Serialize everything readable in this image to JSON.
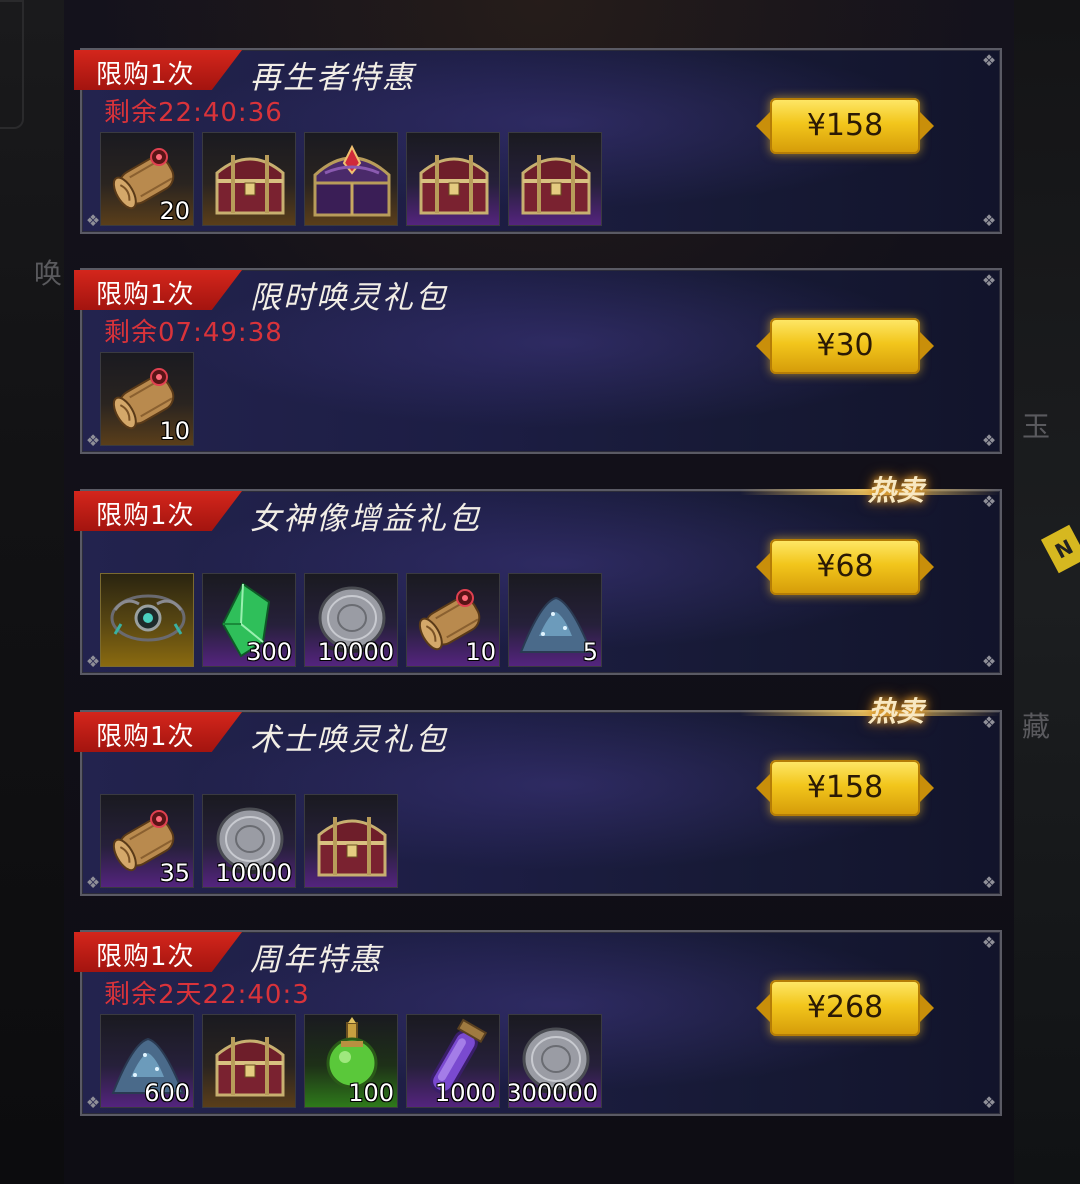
{
  "side": {
    "left_char": "唤",
    "right_chars": [
      "玉",
      "藏"
    ],
    "right_tag": "N"
  },
  "offers": [
    {
      "limit_label": "限购1次",
      "title": "再生者特惠",
      "timer": "剩余22:40:36",
      "hot": "",
      "price": "¥158",
      "items": [
        {
          "icon": "scroll-icon",
          "quality": "brown",
          "count": "20"
        },
        {
          "icon": "chest-icon",
          "quality": "brown",
          "count": ""
        },
        {
          "icon": "purple-chest-icon",
          "quality": "brown",
          "count": ""
        },
        {
          "icon": "chest-icon",
          "quality": "purple",
          "count": ""
        },
        {
          "icon": "chest-icon",
          "quality": "purple",
          "count": ""
        }
      ]
    },
    {
      "limit_label": "限购1次",
      "title": "限时唤灵礼包",
      "timer": "剩余07:49:38",
      "hot": "",
      "price": "¥30",
      "items": [
        {
          "icon": "scroll-icon",
          "quality": "brown",
          "count": "10"
        }
      ]
    },
    {
      "limit_label": "限购1次",
      "title": "女神像增益礼包",
      "timer": "",
      "hot": "热卖",
      "price": "¥68",
      "items": [
        {
          "icon": "amulet-icon",
          "quality": "gold",
          "count": ""
        },
        {
          "icon": "green-crystal-icon",
          "quality": "purple",
          "count": "300"
        },
        {
          "icon": "silver-coin-icon",
          "quality": "purple",
          "count": "10000"
        },
        {
          "icon": "scroll-icon",
          "quality": "purple",
          "count": "10"
        },
        {
          "icon": "dust-pile-icon",
          "quality": "purple",
          "count": "5"
        }
      ]
    },
    {
      "limit_label": "限购1次",
      "title": "术士唤灵礼包",
      "timer": "",
      "hot": "热卖",
      "price": "¥158",
      "items": [
        {
          "icon": "scroll-icon",
          "quality": "purple",
          "count": "35"
        },
        {
          "icon": "silver-coin-icon",
          "quality": "purple",
          "count": "10000"
        },
        {
          "icon": "chest-icon",
          "quality": "purple",
          "count": ""
        }
      ]
    },
    {
      "limit_label": "限购1次",
      "title": "周年特惠",
      "timer": "剩余2天22:40:3",
      "hot": "",
      "price": "¥268",
      "items": [
        {
          "icon": "dust-pile-icon",
          "quality": "purple",
          "count": "600"
        },
        {
          "icon": "chest-icon",
          "quality": "brown",
          "count": ""
        },
        {
          "icon": "green-potion-icon",
          "quality": "green",
          "count": "100"
        },
        {
          "icon": "purple-vial-icon",
          "quality": "purple",
          "count": "1000"
        },
        {
          "icon": "silver-coin-icon",
          "quality": "purple",
          "count": "300000"
        }
      ]
    }
  ],
  "colors": {
    "accent_gold": "#f2c61c",
    "limit_red": "#c41e16",
    "timer_red": "#d9333a"
  }
}
